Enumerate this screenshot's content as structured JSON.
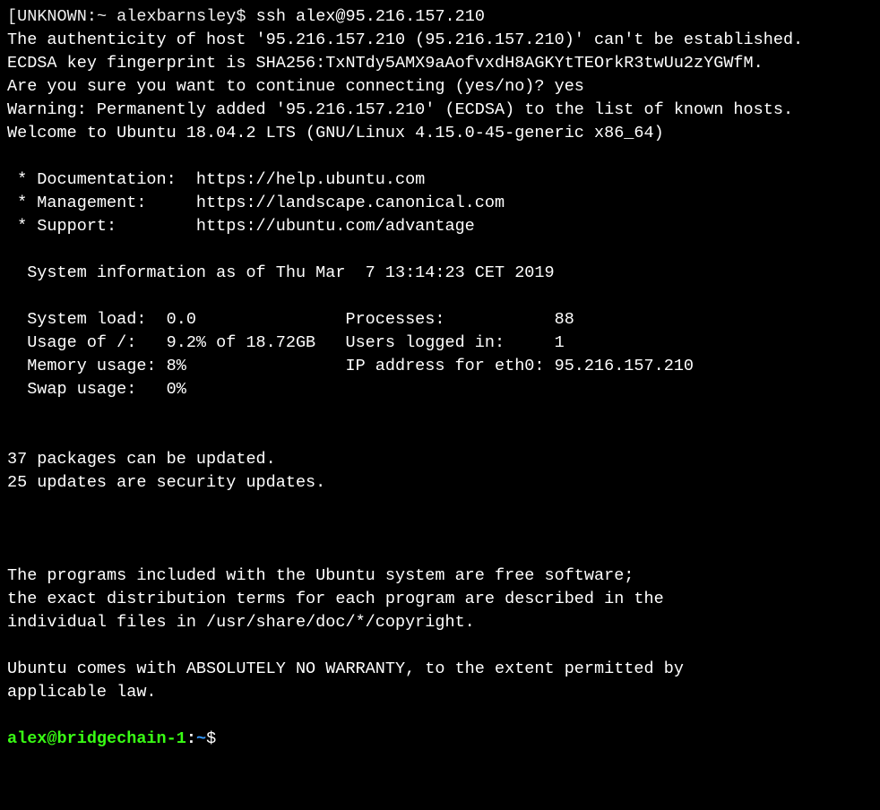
{
  "local_prompt": {
    "bracket": "[",
    "host": "UNKNOWN",
    "sep1": ":",
    "path": "~",
    "sep2": " ",
    "user": "alexbarnsley",
    "dollar": "$"
  },
  "command": "ssh alex@95.216.157.210",
  "lines": {
    "l1": "The authenticity of host '95.216.157.210 (95.216.157.210)' can't be established.",
    "l2": "ECDSA key fingerprint is SHA256:TxNTdy5AMX9aAofvxdH8AGKYtTEOrkR3twUu2zYGWfM.",
    "l3": "Are you sure you want to continue connecting (yes/no)? yes",
    "l4": "Warning: Permanently added '95.216.157.210' (ECDSA) to the list of known hosts.",
    "l5": "Welcome to Ubuntu 18.04.2 LTS (GNU/Linux 4.15.0-45-generic x86_64)"
  },
  "links": {
    "doc": " * Documentation:  https://help.ubuntu.com",
    "mgmt": " * Management:     https://landscape.canonical.com",
    "sup": " * Support:        https://ubuntu.com/advantage"
  },
  "sysinfo_header": "  System information as of Thu Mar  7 13:14:23 CET 2019",
  "sysinfo": {
    "r1": "  System load:  0.0               Processes:           88",
    "r2": "  Usage of /:   9.2% of 18.72GB   Users logged in:     1",
    "r3": "  Memory usage: 8%                IP address for eth0: 95.216.157.210",
    "r4": "  Swap usage:   0%"
  },
  "updates": {
    "u1": "37 packages can be updated.",
    "u2": "25 updates are security updates."
  },
  "legal": {
    "p1": "The programs included with the Ubuntu system are free software;",
    "p2": "the exact distribution terms for each program are described in the",
    "p3": "individual files in /usr/share/doc/*/copyright.",
    "p4": "Ubuntu comes with ABSOLUTELY NO WARRANTY, to the extent permitted by",
    "p5": "applicable law."
  },
  "remote_prompt": {
    "user_host": "alex@bridgechain-1",
    "colon": ":",
    "path": "~",
    "dollar": "$"
  }
}
